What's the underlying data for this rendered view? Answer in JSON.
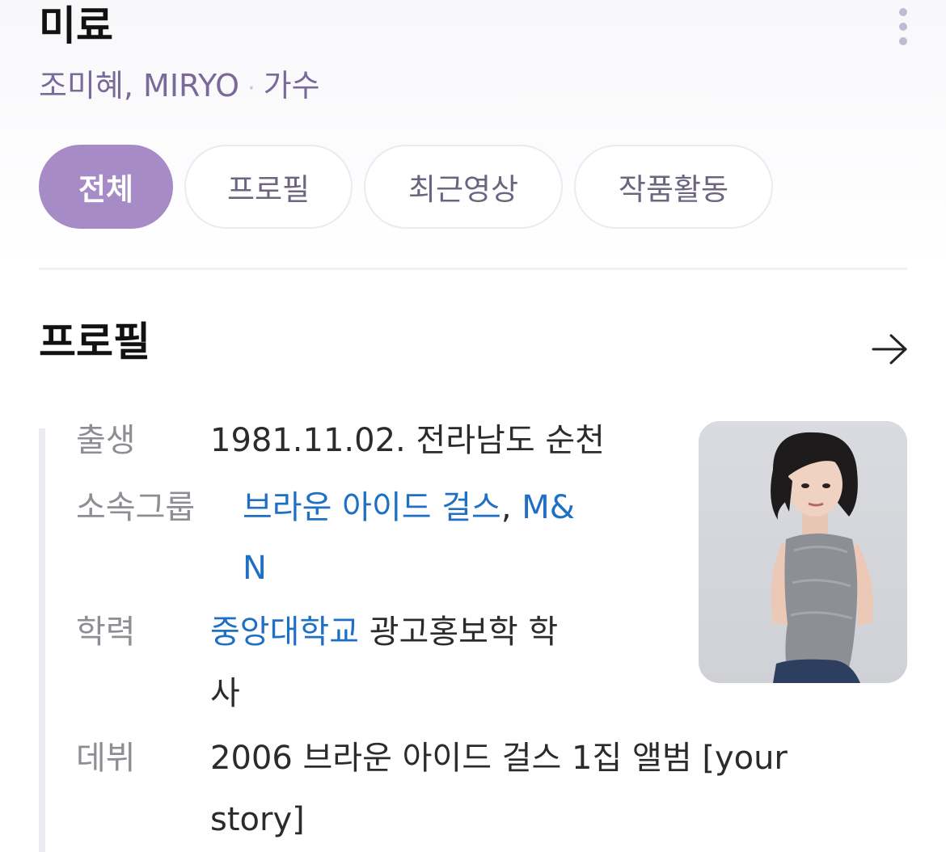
{
  "header": {
    "title": "미료",
    "subtitle_names": "조미혜, MIRYO",
    "subtitle_separator": "·",
    "subtitle_role": "가수"
  },
  "tabs": [
    {
      "label": "전체",
      "active": true
    },
    {
      "label": "프로필",
      "active": false
    },
    {
      "label": "최근영상",
      "active": false
    },
    {
      "label": "작품활동",
      "active": false
    }
  ],
  "profile": {
    "section_title": "프로필",
    "rows": {
      "birth": {
        "label": "출생",
        "value": "1981.11.02. 전라남도 순천"
      },
      "group": {
        "label": "소속그룹",
        "link1": "브라운 아이드 걸스",
        "separator": ",",
        "link2_line1": "M&",
        "link2_line2": "N"
      },
      "education": {
        "label": "학력",
        "link": "중앙대학교",
        "rest_line1": " 광고홍보학 학",
        "rest_line2": "사"
      },
      "debut": {
        "label": "데뷔",
        "line1": "2006 브라운 아이드 걸스 1집 앨범 [your",
        "line2": "story]"
      }
    }
  },
  "icons": {
    "more": "more-vertical-icon",
    "arrow": "arrow-right-icon"
  },
  "colors": {
    "accent": "#a68bc7",
    "subtitle": "#7a6a9a",
    "link": "#1f6fc4",
    "label": "#8d8d94"
  }
}
